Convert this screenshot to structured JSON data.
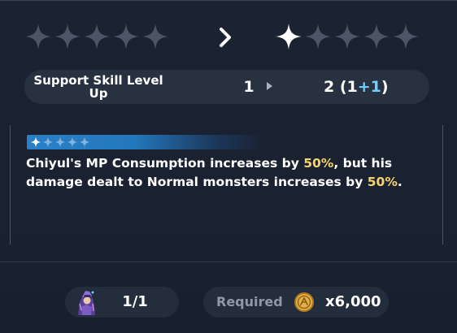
{
  "stars_before": {
    "filled": 0,
    "total": 5
  },
  "stars_after": {
    "filled": 1,
    "total": 5
  },
  "level_up": {
    "label": "Support Skill Level Up",
    "from": "1",
    "to_base": "2 (1",
    "to_bonus": "+1",
    "to_close": ")"
  },
  "effect": {
    "rank_filled": 1,
    "rank_total": 5,
    "text_1": "Chiyul's MP Consumption increases by ",
    "value_1": "50%",
    "text_2": ", but his damage dealt to Normal monsters increases by ",
    "value_2": "50%",
    "text_3": "."
  },
  "footer": {
    "owned_count": "1/1",
    "required_label": "Required",
    "cost": "x6,000"
  },
  "colors": {
    "highlight": "#f6d36b",
    "bonus": "#6fd0ff",
    "star_empty": "#4b5566",
    "star_filled": "#ffffff",
    "rank_bar": "#2a7fc6",
    "coin": "#d9a53a"
  },
  "icons": {
    "portrait": "character-portrait-icon",
    "coin": "gold-coin-icon",
    "arrow": "chevron-right-icon",
    "star": "star-icon"
  }
}
